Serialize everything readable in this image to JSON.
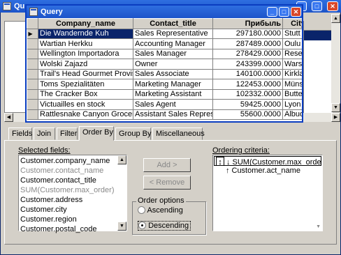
{
  "back_window": {
    "title": "Qu"
  },
  "query_window": {
    "title": "Query"
  },
  "grid": {
    "columns": [
      "Company_name",
      "Contact_title",
      "Прибыль",
      "City"
    ],
    "rows": [
      [
        "Die Wandernde Kuh",
        "Sales Representative",
        "297180.0000",
        "Stutt"
      ],
      [
        "Wartian Herkku",
        "Accounting Manager",
        "287489.0000",
        "Oulu"
      ],
      [
        "Wellington Importadora",
        "Sales Manager",
        "278429.0000",
        "Rese"
      ],
      [
        "Wolski Zajazd",
        "Owner",
        "243399.0000",
        "Wars"
      ],
      [
        "Trail's Head Gourmet Provisioners",
        "Sales Associate",
        "140100.0000",
        "Kirkla"
      ],
      [
        "Toms Spezialitäten",
        "Marketing Manager",
        "122453.0000",
        "Müns"
      ],
      [
        "The Cracker Box",
        "Marketing Assistant",
        "102332.0000",
        "Butte"
      ],
      [
        "Victuailles en stock",
        "Sales Agent",
        "59425.0000",
        "Lyon"
      ],
      [
        "Rattlesnake Canyon Grocery",
        "Assistant Sales Repres.",
        "55600.0000",
        "Albuq"
      ]
    ]
  },
  "tabs": [
    "Fields",
    "Join",
    "Filter",
    "Order By",
    "Group By",
    "Miscellaneous"
  ],
  "active_tab": "Order By",
  "selected_fields": {
    "label": "Selected fields:",
    "items": [
      {
        "text": "Customer.company_name",
        "grey": false
      },
      {
        "text": "Customer.contact_name",
        "grey": true
      },
      {
        "text": "Customer.contact_title",
        "grey": false
      },
      {
        "text": "SUM(Customer.max_order)",
        "grey": true
      },
      {
        "text": "Customer.address",
        "grey": false
      },
      {
        "text": "Customer.city",
        "grey": false
      },
      {
        "text": "Customer.region",
        "grey": false
      },
      {
        "text": "Customer.postal_code",
        "grey": false
      }
    ]
  },
  "buttons": {
    "add": "Add >",
    "remove": "< Remove"
  },
  "order_options": {
    "label": "Order options",
    "ascending": "Ascending",
    "descending": "Descending",
    "selected": "descending"
  },
  "ordering": {
    "label": "Ordering criteria:",
    "items": [
      {
        "arrow": "↓",
        "text": "SUM(Customer.max_order)",
        "editing": true
      },
      {
        "arrow": "↑",
        "text": "Customer.act_name",
        "editing": false
      }
    ]
  }
}
